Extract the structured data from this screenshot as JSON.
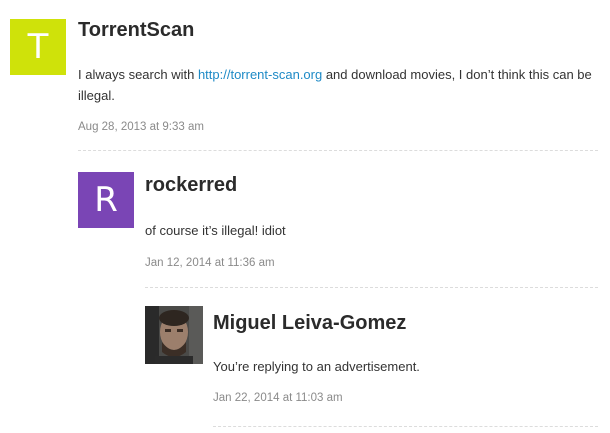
{
  "comments": [
    {
      "author": "TorrentScan",
      "avatar_letter": "T",
      "avatar_color": "#cfe20a",
      "text_before": "I always search with ",
      "link": "http://torrent-scan.org",
      "text_after": " and download movies, I don’t think this can be illegal.",
      "date": "Aug 28, 2013 at 9:33 am"
    },
    {
      "author": "rockerred",
      "avatar_letter": "R",
      "avatar_color": "#7a45b5",
      "text": "of course it’s illegal! idiot",
      "date": "Jan 12, 2014 at 11:36 am"
    },
    {
      "author": "Miguel Leiva-Gomez",
      "avatar_type": "photo",
      "text": "You’re replying to an advertisement.",
      "date": "Jan 22, 2014 at 11:03 am"
    }
  ]
}
